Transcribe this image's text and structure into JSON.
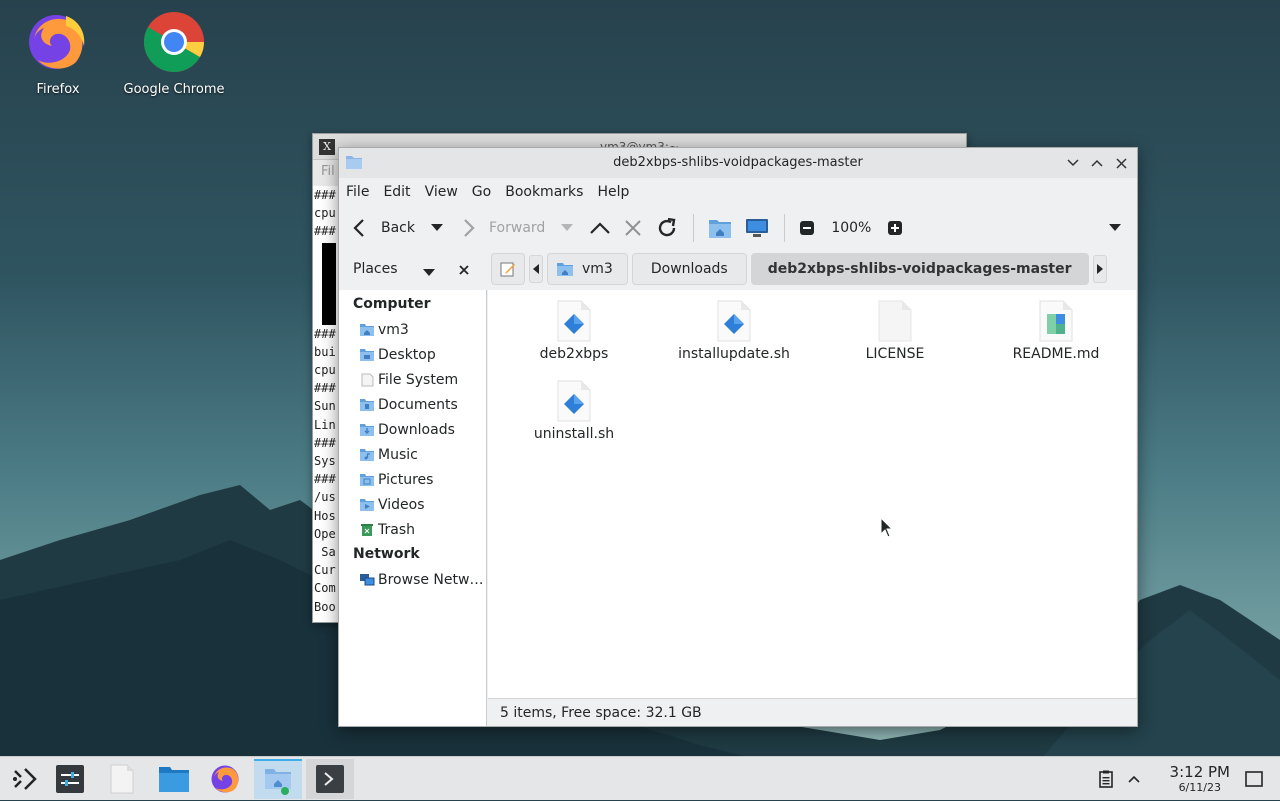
{
  "desktop": {
    "icons": [
      {
        "label": "Firefox"
      },
      {
        "label": "Google Chrome"
      }
    ]
  },
  "terminal": {
    "title": "vm3@vm3:~",
    "menu_label": "Fil",
    "lines": [
      "###",
      "cpu",
      "###",
      "",
      "",
      "",
      "",
      "###",
      "bui",
      "cpu",
      "###",
      "Sun",
      "Lin",
      "###",
      "Sys",
      "###",
      "/us",
      "Hos",
      "Ope",
      " Sa",
      "Cur",
      "Com",
      "Boo"
    ]
  },
  "file_manager": {
    "title": "deb2xbps-shlibs-voidpackages-master",
    "menu": [
      "File",
      "Edit",
      "View",
      "Go",
      "Bookmarks",
      "Help"
    ],
    "toolbar": {
      "back": "Back",
      "forward": "Forward",
      "zoom": "100%"
    },
    "sidebar": {
      "header": "Places",
      "section_computer": "Computer",
      "section_network": "Network",
      "items": [
        {
          "label": "vm3",
          "icon": "home-folder-icon"
        },
        {
          "label": "Desktop",
          "icon": "desktop-folder-icon"
        },
        {
          "label": "File System",
          "icon": "filesystem-icon"
        },
        {
          "label": "Documents",
          "icon": "documents-folder-icon"
        },
        {
          "label": "Downloads",
          "icon": "downloads-folder-icon"
        },
        {
          "label": "Music",
          "icon": "music-folder-icon"
        },
        {
          "label": "Pictures",
          "icon": "pictures-folder-icon"
        },
        {
          "label": "Videos",
          "icon": "videos-folder-icon"
        },
        {
          "label": "Trash",
          "icon": "trash-icon"
        }
      ],
      "network_items": [
        {
          "label": "Browse Netw…",
          "icon": "network-icon"
        }
      ]
    },
    "breadcrumbs": [
      "vm3",
      "Downloads",
      "deb2xbps-shlibs-voidpackages-master"
    ],
    "files": [
      {
        "name": "deb2xbps",
        "icon": "script-file-icon"
      },
      {
        "name": "installupdate.sh",
        "icon": "script-file-icon"
      },
      {
        "name": "LICENSE",
        "icon": "text-file-icon"
      },
      {
        "name": "README.md",
        "icon": "markdown-file-icon"
      },
      {
        "name": "uninstall.sh",
        "icon": "script-file-icon"
      }
    ],
    "status": "5 items, Free space: 32.1 GB"
  },
  "taskbar": {
    "time": "3:12 PM",
    "date": "6/11/23"
  },
  "colors": {
    "accent": "#3daee9",
    "folder_blue": "#5fa0dd",
    "script_blue": "#2f7fd8"
  }
}
